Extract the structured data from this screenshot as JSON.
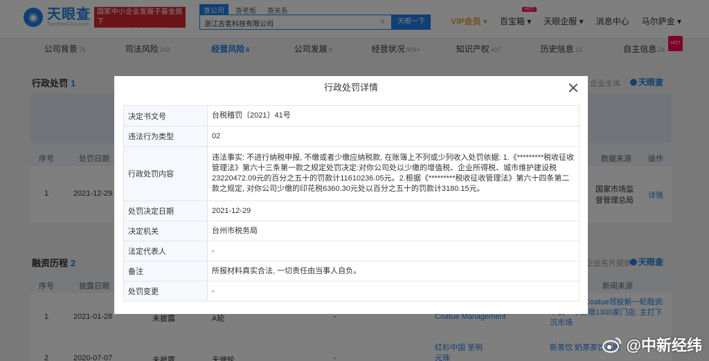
{
  "header": {
    "logo_name": "天眼查",
    "logo_domain": "TianYanCha.com",
    "gov_badge_line1": "国家中小企业发展子基金旗下",
    "gov_badge_line2": "官方备案企业征信机构",
    "search_tabs": [
      "查公司",
      "查老板",
      "查关系"
    ],
    "search_value": "浙江古茗科技有限公司",
    "search_button": "天眼一下",
    "nav": [
      "VIP会员",
      "百宝箱",
      "天眼企服",
      "消息中心",
      "马尔萨金"
    ],
    "hot_label": "HOT"
  },
  "company_tabs": [
    {
      "label": "公司背景",
      "count": "76"
    },
    {
      "label": "司法风险",
      "count": "243"
    },
    {
      "label": "经营风险",
      "count": "6"
    },
    {
      "label": "公司发展",
      "count": "8"
    },
    {
      "label": "经营状况",
      "count": "909+"
    },
    {
      "label": "知识产权",
      "count": "497"
    },
    {
      "label": "历史信息",
      "count": "23"
    },
    {
      "label": "自主信息",
      "count": "24"
    }
  ],
  "penalty_section": {
    "title": "行政处罚",
    "count": "1",
    "source_text": "企业主体",
    "brand": "天眼查",
    "columns": [
      "序号",
      "处罚日期",
      "数据来源",
      "操作"
    ],
    "row": {
      "index": "1",
      "date": "2021-12-29",
      "source": "国家市场监督管理总局",
      "action": "详情"
    }
  },
  "financing_section": {
    "title": "融资历程",
    "count": "2",
    "source_text": "企业名片提供",
    "brand": "天眼查",
    "columns": [
      "序号",
      "披露日期",
      "新闻来源"
    ],
    "rows": [
      {
        "index": "1",
        "date": "2021-01-28",
        "status": "未披露",
        "round": "A轮",
        "dash": "-",
        "investor": "Coatue Management",
        "news": "茶饮] 再获Coatue领投新一轮融资: 不到一年新增1300家门店, 主打下沉市场"
      },
      {
        "index": "2",
        "date": "2020-07-07",
        "status": "未披露",
        "round": "天使轮",
        "dash": "-",
        "investor": "红杉中国 圣明元珠",
        "news": "新茶饮 奶茶茶饮品牌"
      }
    ]
  },
  "modal": {
    "title": "行政处罚详情",
    "rows": [
      {
        "key": "决定书文号",
        "value": "台税稽罚〔2021〕41号"
      },
      {
        "key": "违法行为类型",
        "value": "02"
      },
      {
        "key": "行政处罚内容",
        "value": "违法事实: 不进行纳税申报, 不缴或者少缴应纳税款, 在账簿上不列或少列收入处罚依据: 1.《*********税收征收管理法》第六十三条第一款之规定处罚决定:对你公司处以少缴的增值税、企业所得税、城市维护建设税23220472.09元的百分之五十的罚款计11610236.05元。2.根据《*********税收征收管理法》第六十四条第二款之规定, 对你公司少缴的印花税6360.30元处以百分之五十的罚款计3180.15元。"
      },
      {
        "key": "处罚决定日期",
        "value": "2021-12-29"
      },
      {
        "key": "决定机关",
        "value": "台州市税务局"
      },
      {
        "key": "法定代表人",
        "value": "-"
      },
      {
        "key": "备注",
        "value": "所报材料真实合法, 一切责任由当事人自负。"
      },
      {
        "key": "处罚变更",
        "value": "-"
      }
    ]
  },
  "watermark": {
    "text": "@中新经纬"
  }
}
